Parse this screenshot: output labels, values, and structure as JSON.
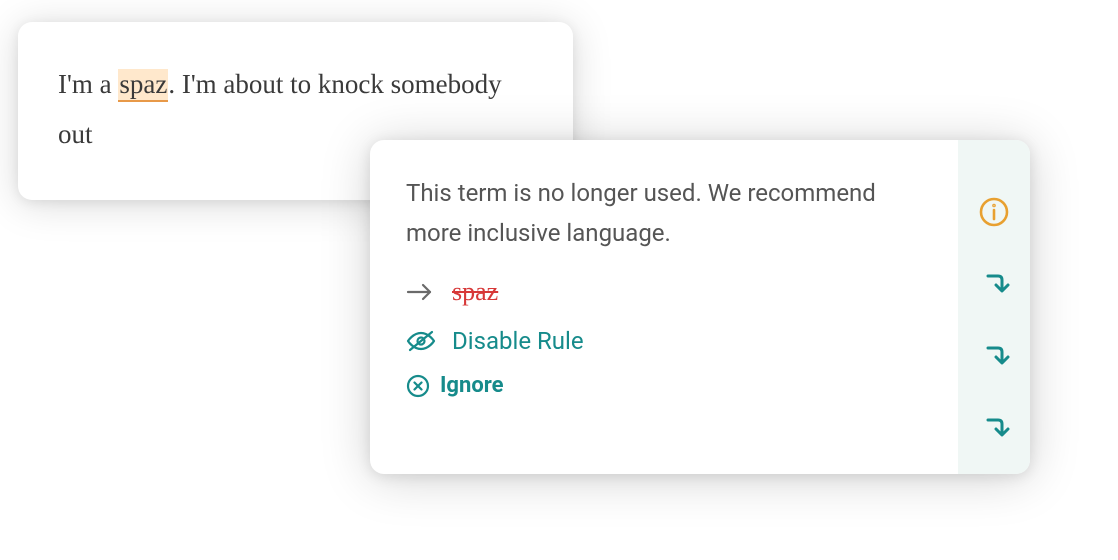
{
  "editor": {
    "text_before": "I'm a ",
    "highlighted": "spaz",
    "text_after": ". I'm about to knock somebody out"
  },
  "suggestion": {
    "description": "This term is no longer used. We recommend more inclusive language.",
    "flagged_term": "spaz",
    "disable_label": "Disable Rule",
    "ignore_label": "Ignore"
  }
}
